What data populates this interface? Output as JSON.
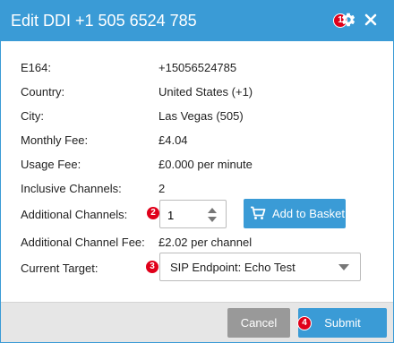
{
  "dialog": {
    "title": "Edit DDI +1 505 6524 785"
  },
  "badges": [
    "1",
    "2",
    "3",
    "4"
  ],
  "details": [
    {
      "label": "E164:",
      "value": "+15056524785"
    },
    {
      "label": "Country:",
      "value": "United States (+1)"
    },
    {
      "label": "City:",
      "value": "Las Vegas (505)"
    },
    {
      "label": "Monthly Fee:",
      "value": "£4.04"
    },
    {
      "label": "Usage Fee:",
      "value": "£0.000 per minute"
    },
    {
      "label": "Inclusive Channels:",
      "value": "2"
    }
  ],
  "additional_channels": {
    "label": "Additional Channels:",
    "value": "1",
    "add_button_label": "Add to Basket"
  },
  "additional_channel_fee": {
    "label": "Additional Channel Fee:",
    "value": "£2.02 per channel"
  },
  "current_target": {
    "label": "Current Target:",
    "selected": "SIP Endpoint: Echo Test"
  },
  "footer": {
    "cancel_label": "Cancel",
    "submit_label": "Submit"
  },
  "colors": {
    "accent": "#3a9bd6",
    "badge": "#e0001a",
    "cancel": "#999999",
    "footer_bg": "#e6e6e6"
  }
}
